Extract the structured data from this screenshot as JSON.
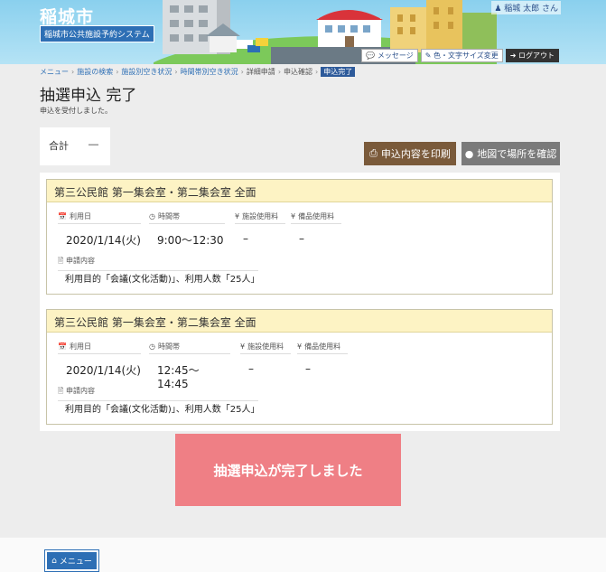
{
  "header": {
    "site_title": "稲城市",
    "site_subtitle": "稲城市公共施設予約システム",
    "user_name": "稲城 太郎 さん",
    "buttons": {
      "message": "メッセージ",
      "color_text_size": "色・文字サイズ変更",
      "logout": "ログアウト"
    }
  },
  "breadcrumb": {
    "items": [
      "メニュー",
      "施設の検索",
      "施設別空き状況",
      "時間帯別空き状況",
      "詳細申請",
      "申込確認"
    ],
    "current": "申込完了"
  },
  "page": {
    "title": "抽選申込 完了",
    "description": "申込を受付しました。"
  },
  "total": {
    "label": "合計",
    "value": "―"
  },
  "actions": {
    "print": "申込内容を印刷",
    "map": "地図で場所を確認"
  },
  "reservations": [
    {
      "facility": "第三公民館 第一集会室・第二集会室 全面",
      "date_label": "利用日",
      "date": "2020/1/14(火)",
      "time_label": "時間帯",
      "time": "9:00～12:30",
      "facility_fee_label": "施設使用料",
      "facility_fee": "–",
      "equipment_fee_label": "備品使用料",
      "equipment_fee": "–",
      "content_label": "申請内容",
      "content": "利用目的「会議(文化活動)」、利用人数「25人」"
    },
    {
      "facility": "第三公民館 第一集会室・第二集会室 全面",
      "date_label": "利用日",
      "date": "2020/1/14(火)",
      "time_label": "時間帯",
      "time": "12:45～14:45",
      "facility_fee_label": "施設使用料",
      "facility_fee": "–",
      "equipment_fee_label": "備品使用料",
      "equipment_fee": "–",
      "content_label": "申請内容",
      "content": "利用目的「会議(文化活動)」、利用人数「25人」"
    }
  ],
  "completion_message": "抽選申込が完了しました",
  "footer": {
    "menu_label": "メニュー"
  },
  "colors": {
    "brand_blue": "#2d6fb5",
    "card_header": "#fdf3c4",
    "completion": "#ef7f85",
    "print_button": "#7a5a3a",
    "map_button": "#7a7a7a"
  }
}
